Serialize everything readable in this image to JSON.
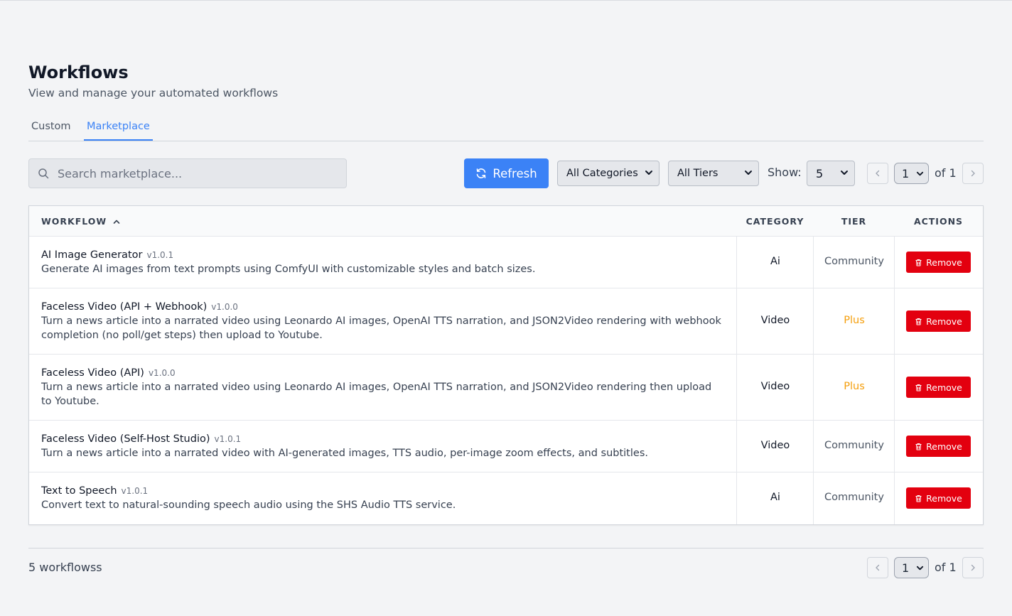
{
  "header": {
    "title": "Workflows",
    "subtitle": "View and manage your automated workflows"
  },
  "tabs": [
    {
      "label": "Custom",
      "active": false
    },
    {
      "label": "Marketplace",
      "active": true
    }
  ],
  "toolbar": {
    "search_placeholder": "Search marketplace...",
    "refresh_label": "Refresh",
    "category_filter": "All Categories",
    "tier_filter": "All Tiers",
    "show_label": "Show:",
    "page_size": "5",
    "current_page": "1",
    "of_pages": "of 1"
  },
  "table": {
    "columns": [
      "WORKFLOW",
      "CATEGORY",
      "TIER",
      "ACTIONS"
    ],
    "sort_column": "WORKFLOW",
    "sort_direction": "ascending",
    "remove_label": "Remove",
    "rows": [
      {
        "name": "AI Image Generator",
        "version": "v1.0.1",
        "description": "Generate AI images from text prompts using ComfyUI with customizable styles and batch sizes.",
        "category": "Ai",
        "tier": "Community"
      },
      {
        "name": "Faceless Video (API + Webhook)",
        "version": "v1.0.0",
        "description": "Turn a news article into a narrated video using Leonardo AI images, OpenAI TTS narration, and JSON2Video rendering with webhook completion (no poll/get steps) then upload to Youtube.",
        "category": "Video",
        "tier": "Plus"
      },
      {
        "name": "Faceless Video (API)",
        "version": "v1.0.0",
        "description": "Turn a news article into a narrated video using Leonardo AI images, OpenAI TTS narration, and JSON2Video rendering then upload to Youtube.",
        "category": "Video",
        "tier": "Plus"
      },
      {
        "name": "Faceless Video (Self-Host Studio)",
        "version": "v1.0.1",
        "description": "Turn a news article into a narrated video with AI-generated images, TTS audio, per-image zoom effects, and subtitles.",
        "category": "Video",
        "tier": "Community"
      },
      {
        "name": "Text to Speech",
        "version": "v1.0.1",
        "description": "Convert text to natural-sounding speech audio using the SHS Audio TTS service.",
        "category": "Ai",
        "tier": "Community"
      }
    ]
  },
  "footer": {
    "count_text": "5 workflowss",
    "current_page": "1",
    "of_pages": "of 1"
  },
  "colors": {
    "accent": "#3b82f6",
    "danger": "#e3000f",
    "plus_tier": "#f59e0b"
  }
}
